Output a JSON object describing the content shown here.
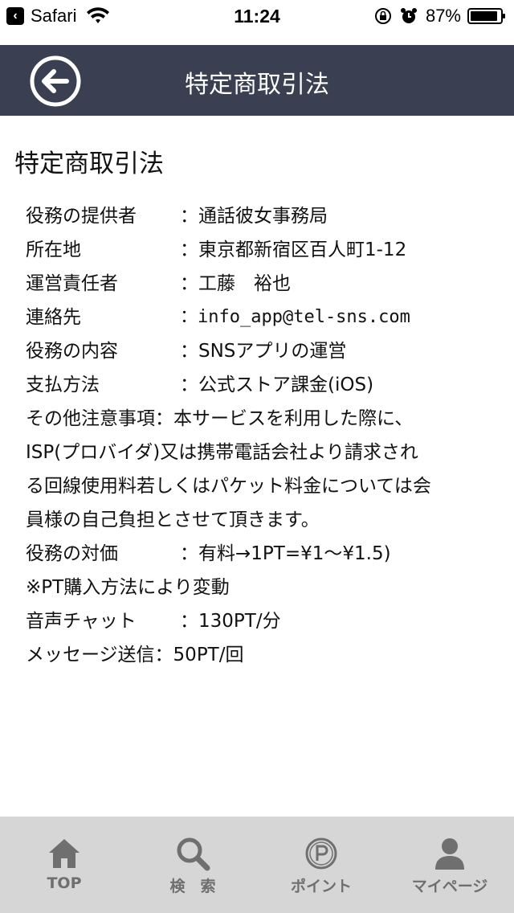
{
  "status_bar": {
    "app": "Safari",
    "time": "11:24",
    "battery": "87%"
  },
  "nav": {
    "title": "特定商取引法"
  },
  "page": {
    "heading": "特定商取引法",
    "rows": [
      {
        "label": "役務の提供者",
        "value": "：通話彼女事務局"
      },
      {
        "label": "所在地",
        "value": "：東京都新宿区百人町1-12"
      },
      {
        "label": "運営責任者",
        "value": "：工藤　裕也"
      },
      {
        "label": "連絡先",
        "value": "：info_app@tel-sns.com"
      },
      {
        "label": "役務の内容",
        "value": "：SNSアプリの運営"
      },
      {
        "label": "支払方法",
        "value": "：公式ストア課金(iOS)"
      }
    ],
    "notes": {
      "label": "その他注意事項",
      "line1": "：本サービスを利用した際に、",
      "line2": "ISP(プロバイダ)又は携帯電話会社より請求され",
      "line3": "る回線使用料若しくはパケット料金については会",
      "line4": "員様の自己負担とさせて頂きます。"
    },
    "price": {
      "label": "役務の対価",
      "value": "：有料→1PT=¥1〜¥1.5)",
      "note": "※PT購入方法により変動"
    },
    "voice": {
      "label": "音声チャット",
      "value": "：130PT/分"
    },
    "message": {
      "label": "メッセージ送信",
      "value": "：50PT/回"
    }
  },
  "tabbar": {
    "items": [
      {
        "label": "TOP",
        "icon": "home-icon"
      },
      {
        "label": "検　索",
        "icon": "search-icon"
      },
      {
        "label": "ポイント",
        "icon": "point-icon"
      },
      {
        "label": "マイページ",
        "icon": "person-icon"
      }
    ]
  }
}
